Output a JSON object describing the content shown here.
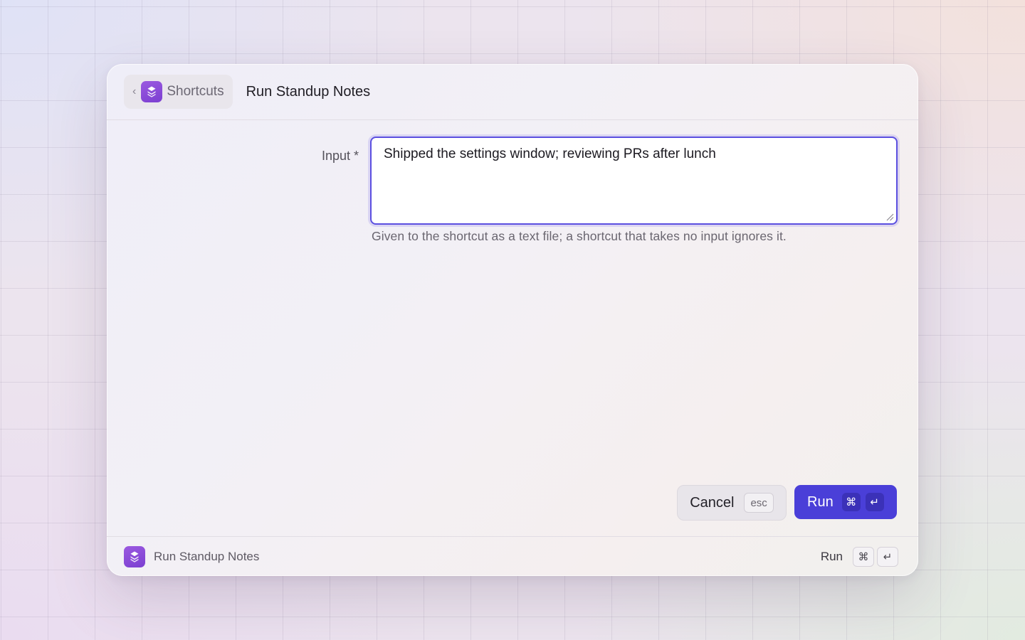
{
  "header": {
    "back_label": "Shortcuts",
    "back_chevron": "‹",
    "title": "Run Standup Notes"
  },
  "form": {
    "input_label": "Input *",
    "input_value": "Shipped the settings window; reviewing PRs after lunch",
    "input_hint": "Given to the shortcut as a text file; a shortcut that takes no input ignores it."
  },
  "actions": {
    "cancel_label": "Cancel",
    "cancel_key": "esc",
    "run_label": "Run",
    "run_key_cmd": "⌘",
    "run_key_return": "↵"
  },
  "footer": {
    "title": "Run Standup Notes",
    "run_label": "Run",
    "key_cmd": "⌘",
    "key_return": "↵"
  },
  "icons": {
    "app": "shortcuts-stack-icon",
    "back": "chevron-left-icon"
  },
  "colors": {
    "accent": "#4a3fd8",
    "app_icon": "#8a4bd9"
  }
}
